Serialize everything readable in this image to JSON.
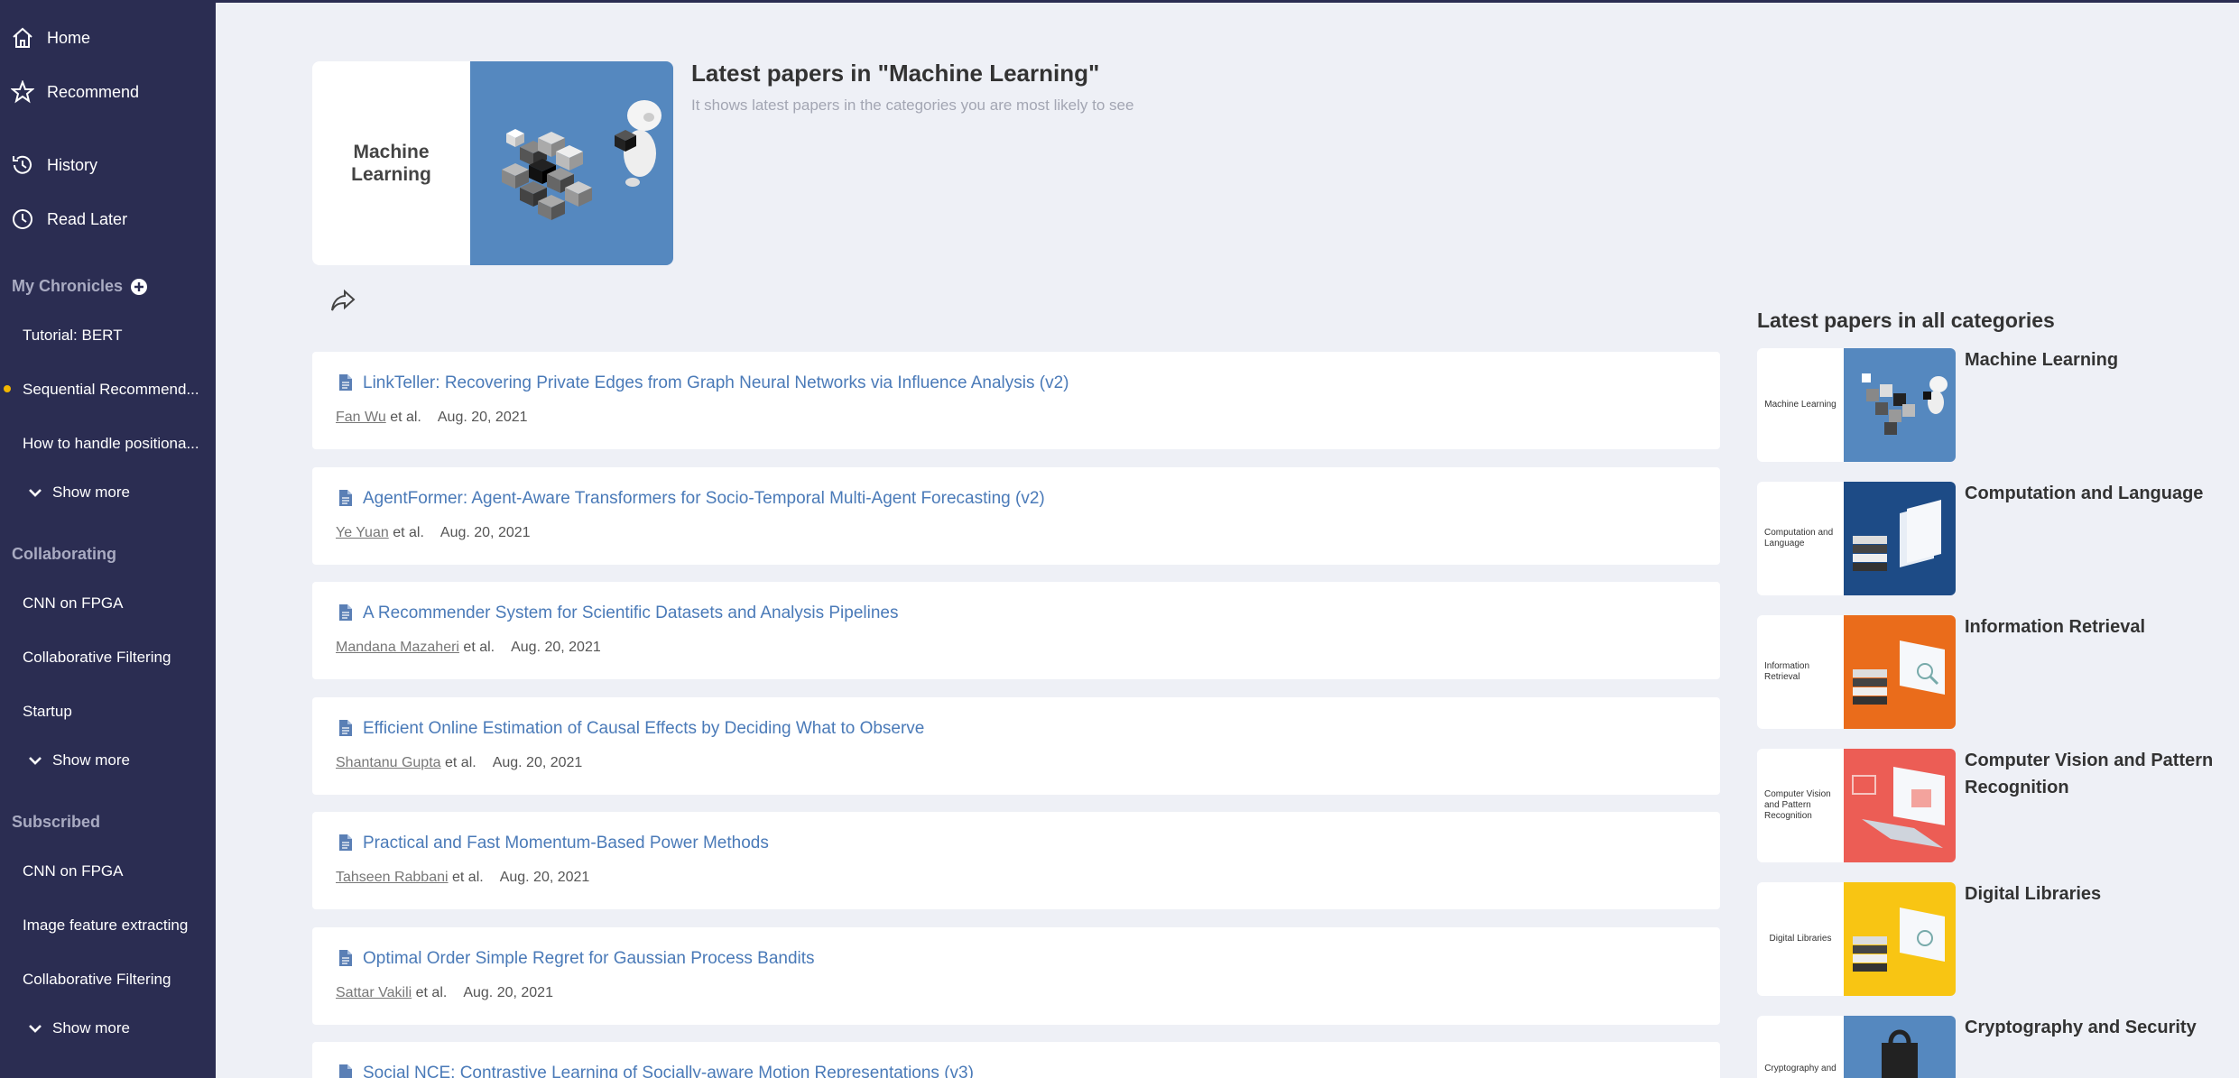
{
  "sidebar": {
    "nav": [
      {
        "label": "Home",
        "icon": "home-icon"
      },
      {
        "label": "Recommend",
        "icon": "star-icon"
      },
      {
        "label": "History",
        "icon": "history-icon"
      },
      {
        "label": "Read Later",
        "icon": "clock-icon"
      }
    ],
    "chronicles_title": "My Chronicles",
    "chronicles": [
      "Tutorial: BERT",
      "Sequential Recommend...",
      "How to handle positiona..."
    ],
    "collaborating_title": "Collaborating",
    "collaborating": [
      "CNN on FPGA",
      "Collaborative Filtering",
      "Startup"
    ],
    "subscribed_title": "Subscribed",
    "subscribed": [
      "CNN on FPGA",
      "Image feature extracting",
      "Collaborative Filtering"
    ],
    "show_more": "Show more",
    "dot_color": "#f2b600"
  },
  "header": {
    "hero_label": "Machine Learning",
    "title": "Latest papers in \"Machine Learning\"",
    "subtitle": "It shows latest papers in the categories you are most likely to see"
  },
  "papers": [
    {
      "title": "LinkTeller: Recovering Private Edges from Graph Neural Networks via Influence Analysis (v2)",
      "author": "Fan Wu",
      "etal": "et al.",
      "date": "Aug. 20, 2021"
    },
    {
      "title": "AgentFormer: Agent-Aware Transformers for Socio-Temporal Multi-Agent Forecasting (v2)",
      "author": "Ye Yuan",
      "etal": "et al.",
      "date": "Aug. 20, 2021"
    },
    {
      "title": "A Recommender System for Scientific Datasets and Analysis Pipelines",
      "author": "Mandana Mazaheri",
      "etal": "et al.",
      "date": "Aug. 20, 2021"
    },
    {
      "title": "Efficient Online Estimation of Causal Effects by Deciding What to Observe",
      "author": "Shantanu Gupta",
      "etal": "et al.",
      "date": "Aug. 20, 2021"
    },
    {
      "title": "Practical and Fast Momentum-Based Power Methods",
      "author": "Tahseen Rabbani",
      "etal": "et al.",
      "date": "Aug. 20, 2021"
    },
    {
      "title": "Optimal Order Simple Regret for Gaussian Process Bandits",
      "author": "Sattar Vakili",
      "etal": "et al.",
      "date": "Aug. 20, 2021"
    },
    {
      "title": "Social NCE: Contrastive Learning of Socially-aware Motion Representations (v3)",
      "author": "",
      "etal": "",
      "date": ""
    }
  ],
  "categories_title": "Latest papers in all categories",
  "categories": [
    {
      "name": "Machine Learning",
      "thumb": "Machine Learning",
      "color": "#5588bf"
    },
    {
      "name": "Computation and Language",
      "thumb": "Computation and Language",
      "color": "#1d4b86"
    },
    {
      "name": "Information Retrieval",
      "thumb": "Information Retrieval",
      "color": "#ea6c1b"
    },
    {
      "name": "Computer Vision and Pattern Recognition",
      "thumb": "Computer Vision and Pattern Recognition",
      "color": "#ec5d55"
    },
    {
      "name": "Digital Libraries",
      "thumb": "Digital Libraries",
      "color": "#f8c513"
    },
    {
      "name": "Cryptography and Security",
      "thumb": "Cryptography and",
      "color": "#5588bf"
    }
  ]
}
